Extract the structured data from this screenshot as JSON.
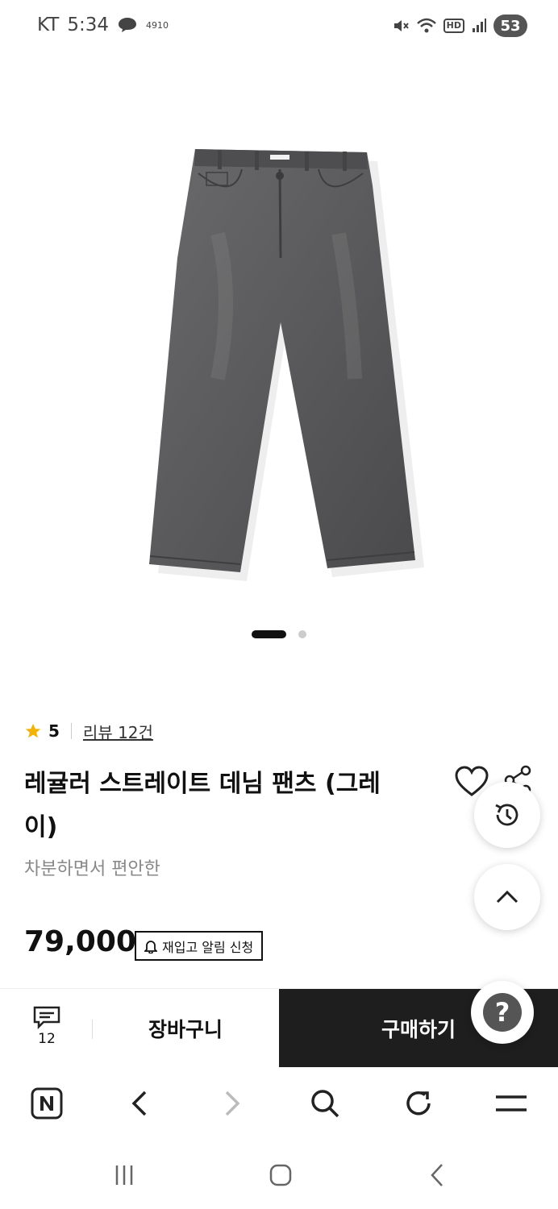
{
  "status_bar": {
    "carrier": "KT",
    "time": "5:34",
    "notification_text": "4910",
    "battery": "53"
  },
  "carousel": {
    "total": 2,
    "active": 1
  },
  "product": {
    "rating": "5",
    "review_link": "리뷰 12건",
    "title": "레귤러 스트레이트 데님 팬츠 (그레이)",
    "subtitle": "차분하면서 편안한",
    "price": "79,000",
    "restock_label": "재입고 알림 신청"
  },
  "action_bar": {
    "chat_count": "12",
    "cart_label": "장바구니",
    "buy_label": "구매하기"
  },
  "floating": {
    "help_label": "?"
  },
  "colors": {
    "buy_bg": "#1e1e1e",
    "star": "#f5b301",
    "denim": "#5b5b5d"
  }
}
